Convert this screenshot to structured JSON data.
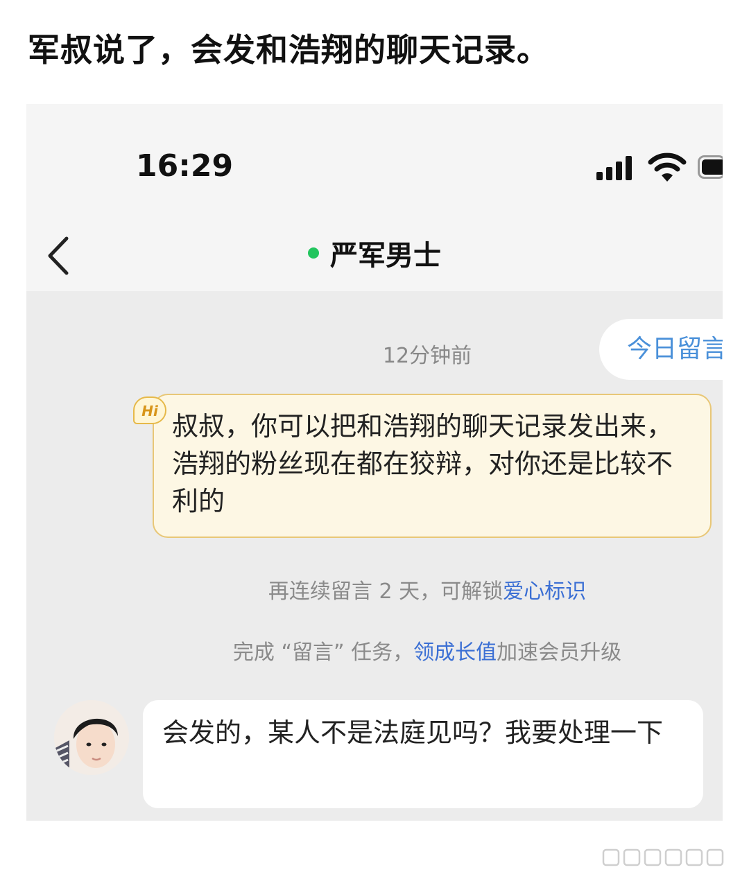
{
  "post": {
    "text": "军叔说了，会发和浩翔的聊天记录。"
  },
  "status_bar": {
    "time": "16:29",
    "icons": [
      "signal-icon",
      "wifi-icon",
      "battery-icon"
    ]
  },
  "nav": {
    "back_icon": "chevron-left-icon",
    "title": "严军男士",
    "online_color": "#22c55e"
  },
  "chat": {
    "today_button": "今日留言",
    "timestamp": "12分钟前",
    "outgoing_badge": "Hi",
    "outgoing_message": "叔叔，你可以把和浩翔的聊天记录发出来，浩翔的粉丝现在都在狡辩，对你还是比较不利的",
    "notice1_prefix": "再连续留言 2 天，可解锁",
    "notice1_link": "爱心标识",
    "notice2_prefix": "完成 “留言” 任务，",
    "notice2_link": "领成长值",
    "notice2_suffix": "加速会员升级",
    "incoming_message": "会发的，某人不是法庭见吗？我要处理一下"
  },
  "colors": {
    "link": "#3b6fd4",
    "outgoing_bubble": "#fdf7e4",
    "outgoing_border": "#e8c777",
    "chat_bg": "#ececec"
  }
}
